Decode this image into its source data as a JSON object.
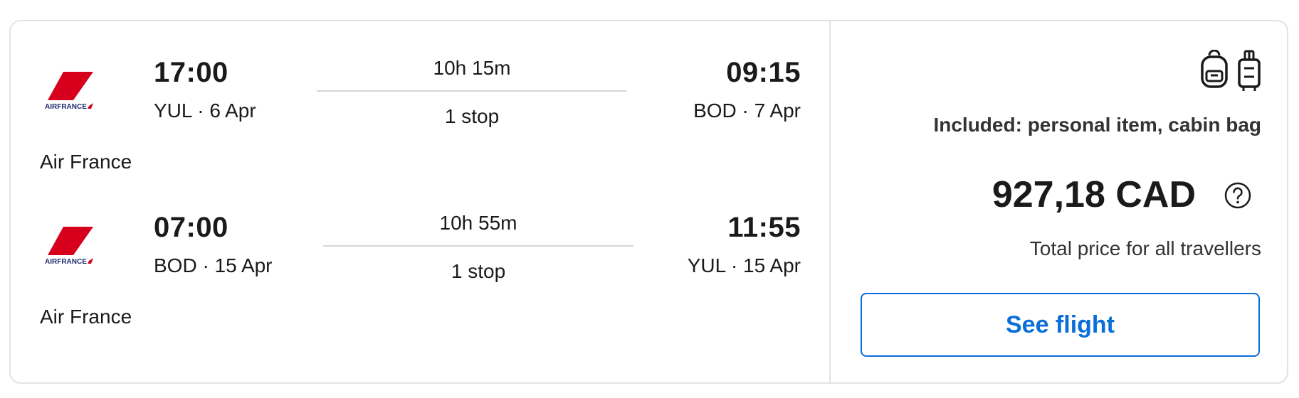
{
  "legs": [
    {
      "departure_time": "17:00",
      "departure_place": "YUL · 6 Apr",
      "duration": "10h 15m",
      "stops": "1 stop",
      "arrival_time": "09:15",
      "arrival_place": "BOD · 7 Apr",
      "airline": "Air France",
      "logo_text": "AIRFRANCE"
    },
    {
      "departure_time": "07:00",
      "departure_place": "BOD · 15 Apr",
      "duration": "10h 55m",
      "stops": "1 stop",
      "arrival_time": "11:55",
      "arrival_place": "YUL · 15 Apr",
      "airline": "Air France",
      "logo_text": "AIRFRANCE"
    }
  ],
  "baggage": {
    "icons": [
      "personal-item-backpack-icon",
      "cabin-bag-suitcase-icon"
    ],
    "included_text": "Included: personal item, cabin bag"
  },
  "price": {
    "amount": "927,18 CAD",
    "note": "Total price for all travellers",
    "help_icon": "question-circle-icon"
  },
  "cta": {
    "label": "See flight"
  },
  "colors": {
    "accent": "#0a6ed8",
    "logo_red": "#d6001c",
    "border": "#e3e3e3"
  }
}
